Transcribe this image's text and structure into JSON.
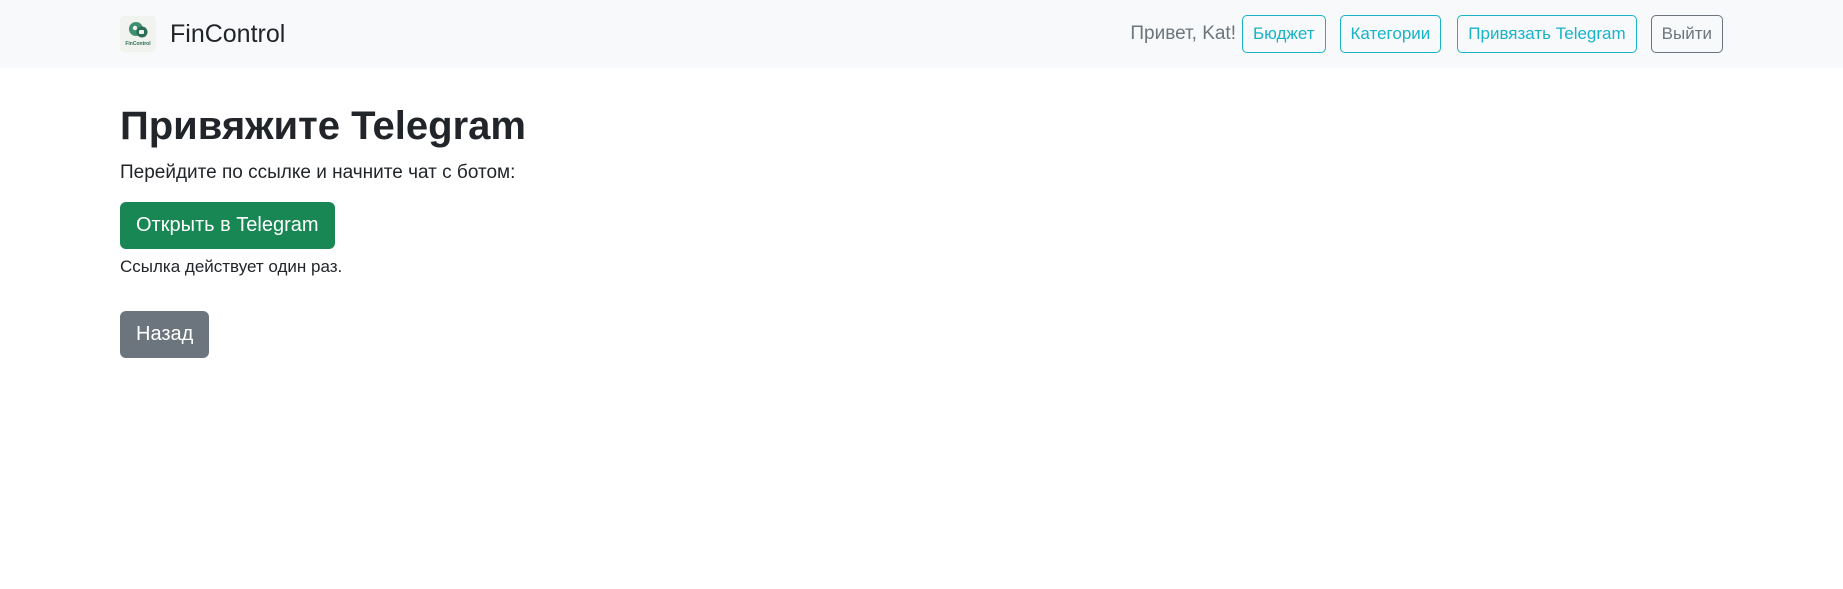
{
  "navbar": {
    "logo_caption": "FinControl",
    "brand_name": "FinControl",
    "greeting": "Привет, Kat!",
    "links": {
      "budget": "Бюджет",
      "categories": "Категории",
      "link_telegram": "Привязать Telegram",
      "logout": "Выйти"
    }
  },
  "main": {
    "title": "Привяжите Telegram",
    "instruction": "Перейдите по ссылке и начните чат с ботом:",
    "open_button": "Открыть в Telegram",
    "note": "Ссылка действует один раз.",
    "back_button": "Назад"
  },
  "colors": {
    "navbar_bg": "#f8f9fa",
    "info": "#17b3c8",
    "success": "#198754",
    "secondary": "#6c757d"
  },
  "icons": {
    "logo": "fincontrol-logo-icon"
  }
}
